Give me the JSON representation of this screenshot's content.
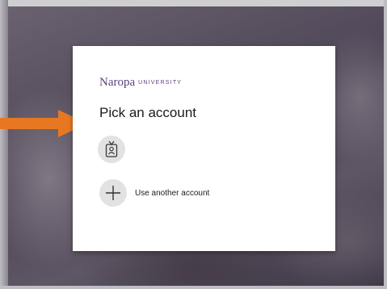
{
  "brand": {
    "name": "Naropa",
    "suffix": "UNIVERSITY",
    "color": "#5b3f7a"
  },
  "dialog": {
    "title": "Pick an account",
    "accounts": [
      {
        "icon": "badge-user-icon"
      }
    ],
    "use_another": {
      "label": "Use another account",
      "icon": "plus-icon"
    }
  },
  "annotation": {
    "icon": "arrow-right-icon",
    "color": "#e87722"
  }
}
